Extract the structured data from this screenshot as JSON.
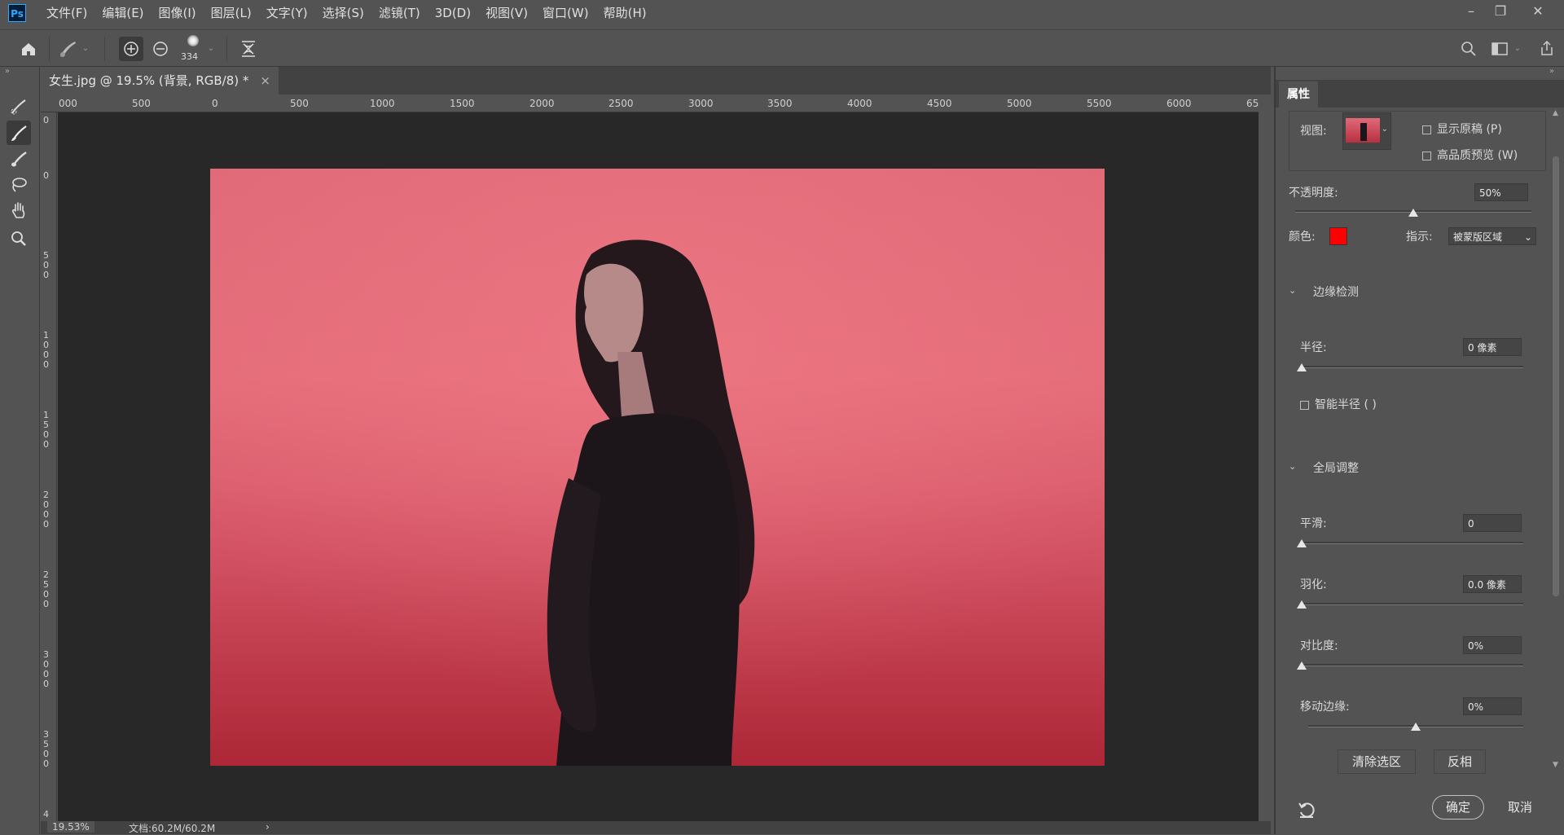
{
  "app": {
    "logo": "Ps"
  },
  "menu": [
    "文件(F)",
    "编辑(E)",
    "图像(I)",
    "图层(L)",
    "文字(Y)",
    "选择(S)",
    "滤镜(T)",
    "3D(D)",
    "视图(V)",
    "窗口(W)",
    "帮助(H)"
  ],
  "window_controls": {
    "minimize": "–",
    "restore": "❐",
    "close": "✕"
  },
  "options": {
    "brush_size": "334"
  },
  "document": {
    "tab_title": "女生.jpg @ 19.5% (背景, RGB/8) *",
    "close": "×"
  },
  "ruler": {
    "top": [
      "000",
      "500",
      "0",
      "500",
      "1000",
      "1500",
      "2000",
      "2500",
      "3000",
      "3500",
      "4000",
      "4500",
      "5000",
      "5500",
      "6000",
      "65"
    ],
    "left": [
      "0",
      "0",
      "500",
      "1000",
      "1500",
      "2000",
      "2500",
      "3000",
      "3500",
      "4"
    ]
  },
  "status": {
    "zoom": "19.53%",
    "doc": "文档:60.2M/60.2M",
    "arrow": "›"
  },
  "panel": {
    "tab": "属性",
    "view_label": "视图:",
    "show_original": "显示原稿 (P)",
    "hq_preview": "高品质预览 (W)",
    "opacity_label": "不透明度:",
    "opacity_value": "50%",
    "opacity_level": 0.5,
    "color_label": "颜色:",
    "color_swatch": "#ff0000",
    "indicate_label": "指示:",
    "indicate_value": "被蒙版区域",
    "edge_section": "边缘检测",
    "radius_label": "半径:",
    "radius_value": "0 像素",
    "smart_radius": "智能半径 ( )",
    "global_section": "全局调整",
    "smooth_label": "平滑:",
    "smooth_value": "0",
    "feather_label": "羽化:",
    "feather_value": "0.0 像素",
    "contrast_label": "对比度:",
    "contrast_value": "0%",
    "shift_label": "移动边缘:",
    "shift_value": "0%",
    "clear_button": "清除选区",
    "invert_button": "反相",
    "ok_button": "确定",
    "cancel_button": "取消"
  }
}
